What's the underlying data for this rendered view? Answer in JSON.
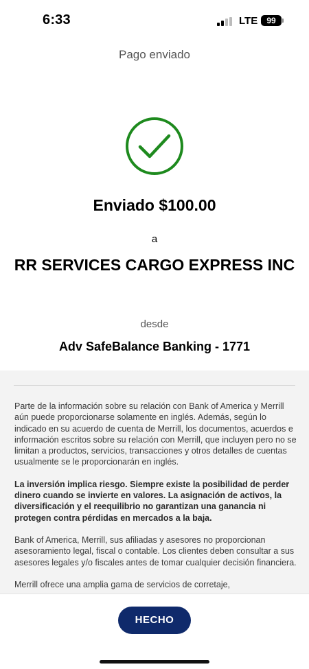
{
  "status_bar": {
    "time": "6:33",
    "network": "LTE",
    "battery": "99"
  },
  "header": {
    "title": "Pago enviado"
  },
  "confirmation": {
    "success_icon": "check-circle-icon",
    "success_color": "#1e8a1e",
    "sent_label": "Enviado $100.00",
    "to_label": "a",
    "recipient": "RR SERVICES CARGO EXPRESS INC",
    "from_label": "desde",
    "account": "Adv SafeBalance Banking - 1771"
  },
  "disclaimer": {
    "para1": "Parte de la información sobre su relación con Bank of America y Merrill aún puede proporcionarse solamente en inglés. Además, según lo indicado en su acuerdo de cuenta de Merrill, los documentos, acuerdos e información escritos sobre su relación con Merrill, que incluyen pero no se limitan a productos, servicios, transacciones y otros detalles de cuentas usualmente se le proporcionarán en inglés.",
    "para2": "La inversión implica riesgo. Siempre existe la posibilidad de perder dinero cuando se invierte en valores. La asignación de activos, la diversificación y el reequilibrio no garantizan una ganancia ni protegen contra pérdidas en mercados a la baja.",
    "para3": "Bank of America, Merrill, sus afiliadas y asesores no proporcionan asesoramiento legal, fiscal o contable. Los clientes deben consultar a sus asesores legales y/o fiscales antes de tomar cualquier decisión financiera.",
    "para4": "Merrill ofrece una amplia gama de servicios de corretaje,"
  },
  "footer": {
    "done_label": "HECHO",
    "button_color": "#0f2a6b"
  }
}
